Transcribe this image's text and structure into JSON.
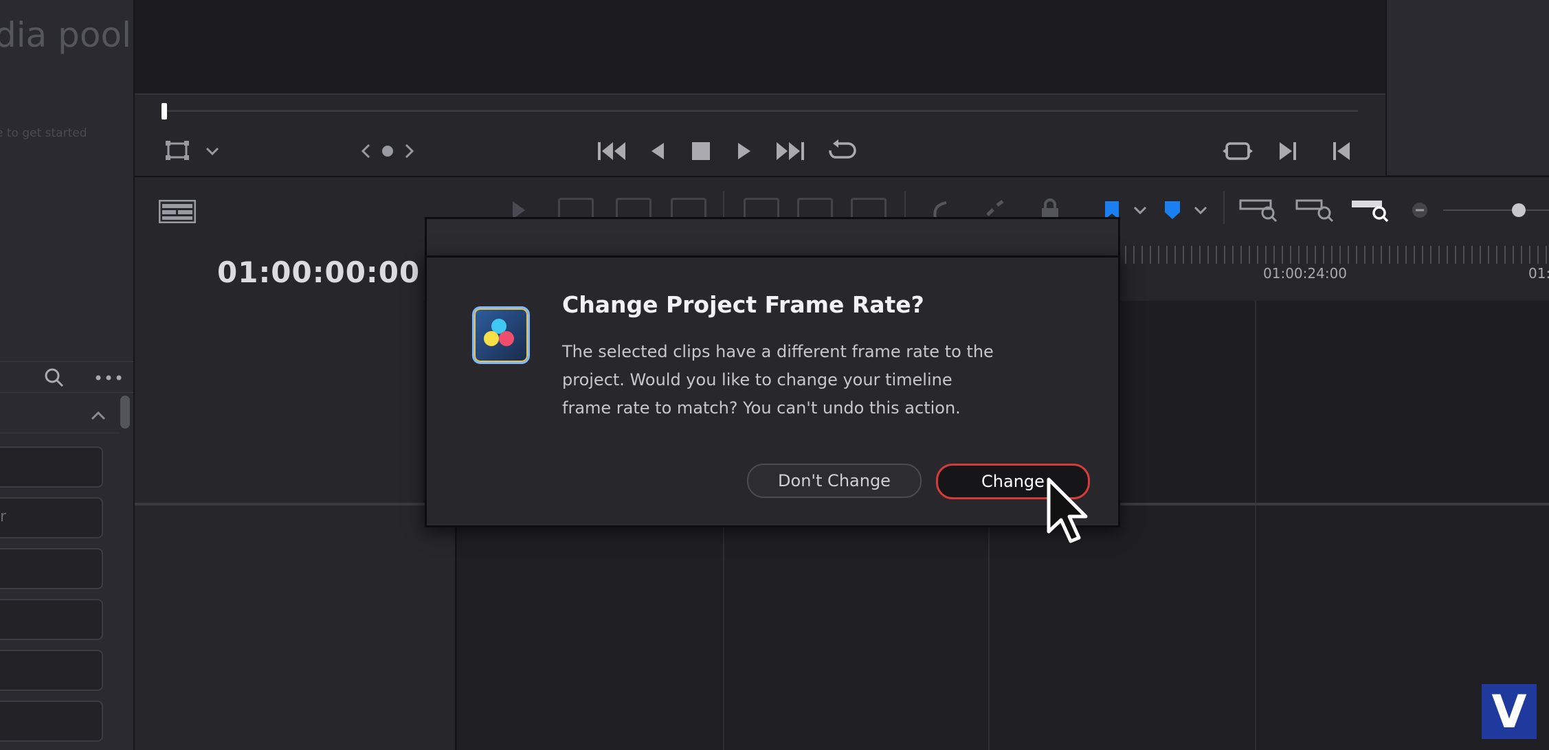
{
  "media_pool": {
    "title": "dia pool",
    "hint": "e to get started",
    "rows": [
      "",
      "r",
      "",
      "",
      "",
      ""
    ]
  },
  "viewer": {
    "timecode": "01:00:00:00"
  },
  "timeline": {
    "ruler_labels": [
      "01:00:24:00",
      "01:"
    ]
  },
  "dialog": {
    "title": "Change Project Frame Rate?",
    "message": "The selected clips have a different frame rate to the project. Would you like to change your timeline frame rate to match? You can't undo this action.",
    "dont_change_label": "Don't Change",
    "change_label": "Change"
  },
  "watermark": {
    "letter": "V"
  },
  "colors": {
    "accent_red": "#d43c3c",
    "flag_blue": "#1a7ff0",
    "panel": "#27272c"
  },
  "icons": [
    "search-icon",
    "more-icon",
    "chevron-up-icon",
    "crop-icon",
    "chevron-down-icon",
    "prev-edit-icon",
    "next-edit-icon",
    "go-to-start-icon",
    "play-reverse-icon",
    "stop-icon",
    "play-icon",
    "go-to-end-icon",
    "loop-icon",
    "match-frame-icon",
    "next-clip-icon",
    "prev-clip-icon",
    "timeline-view-icon",
    "flag-icon",
    "marker-icon",
    "zoom-icon",
    "davinci-resolve-logo",
    "mouse-pointer-icon"
  ]
}
